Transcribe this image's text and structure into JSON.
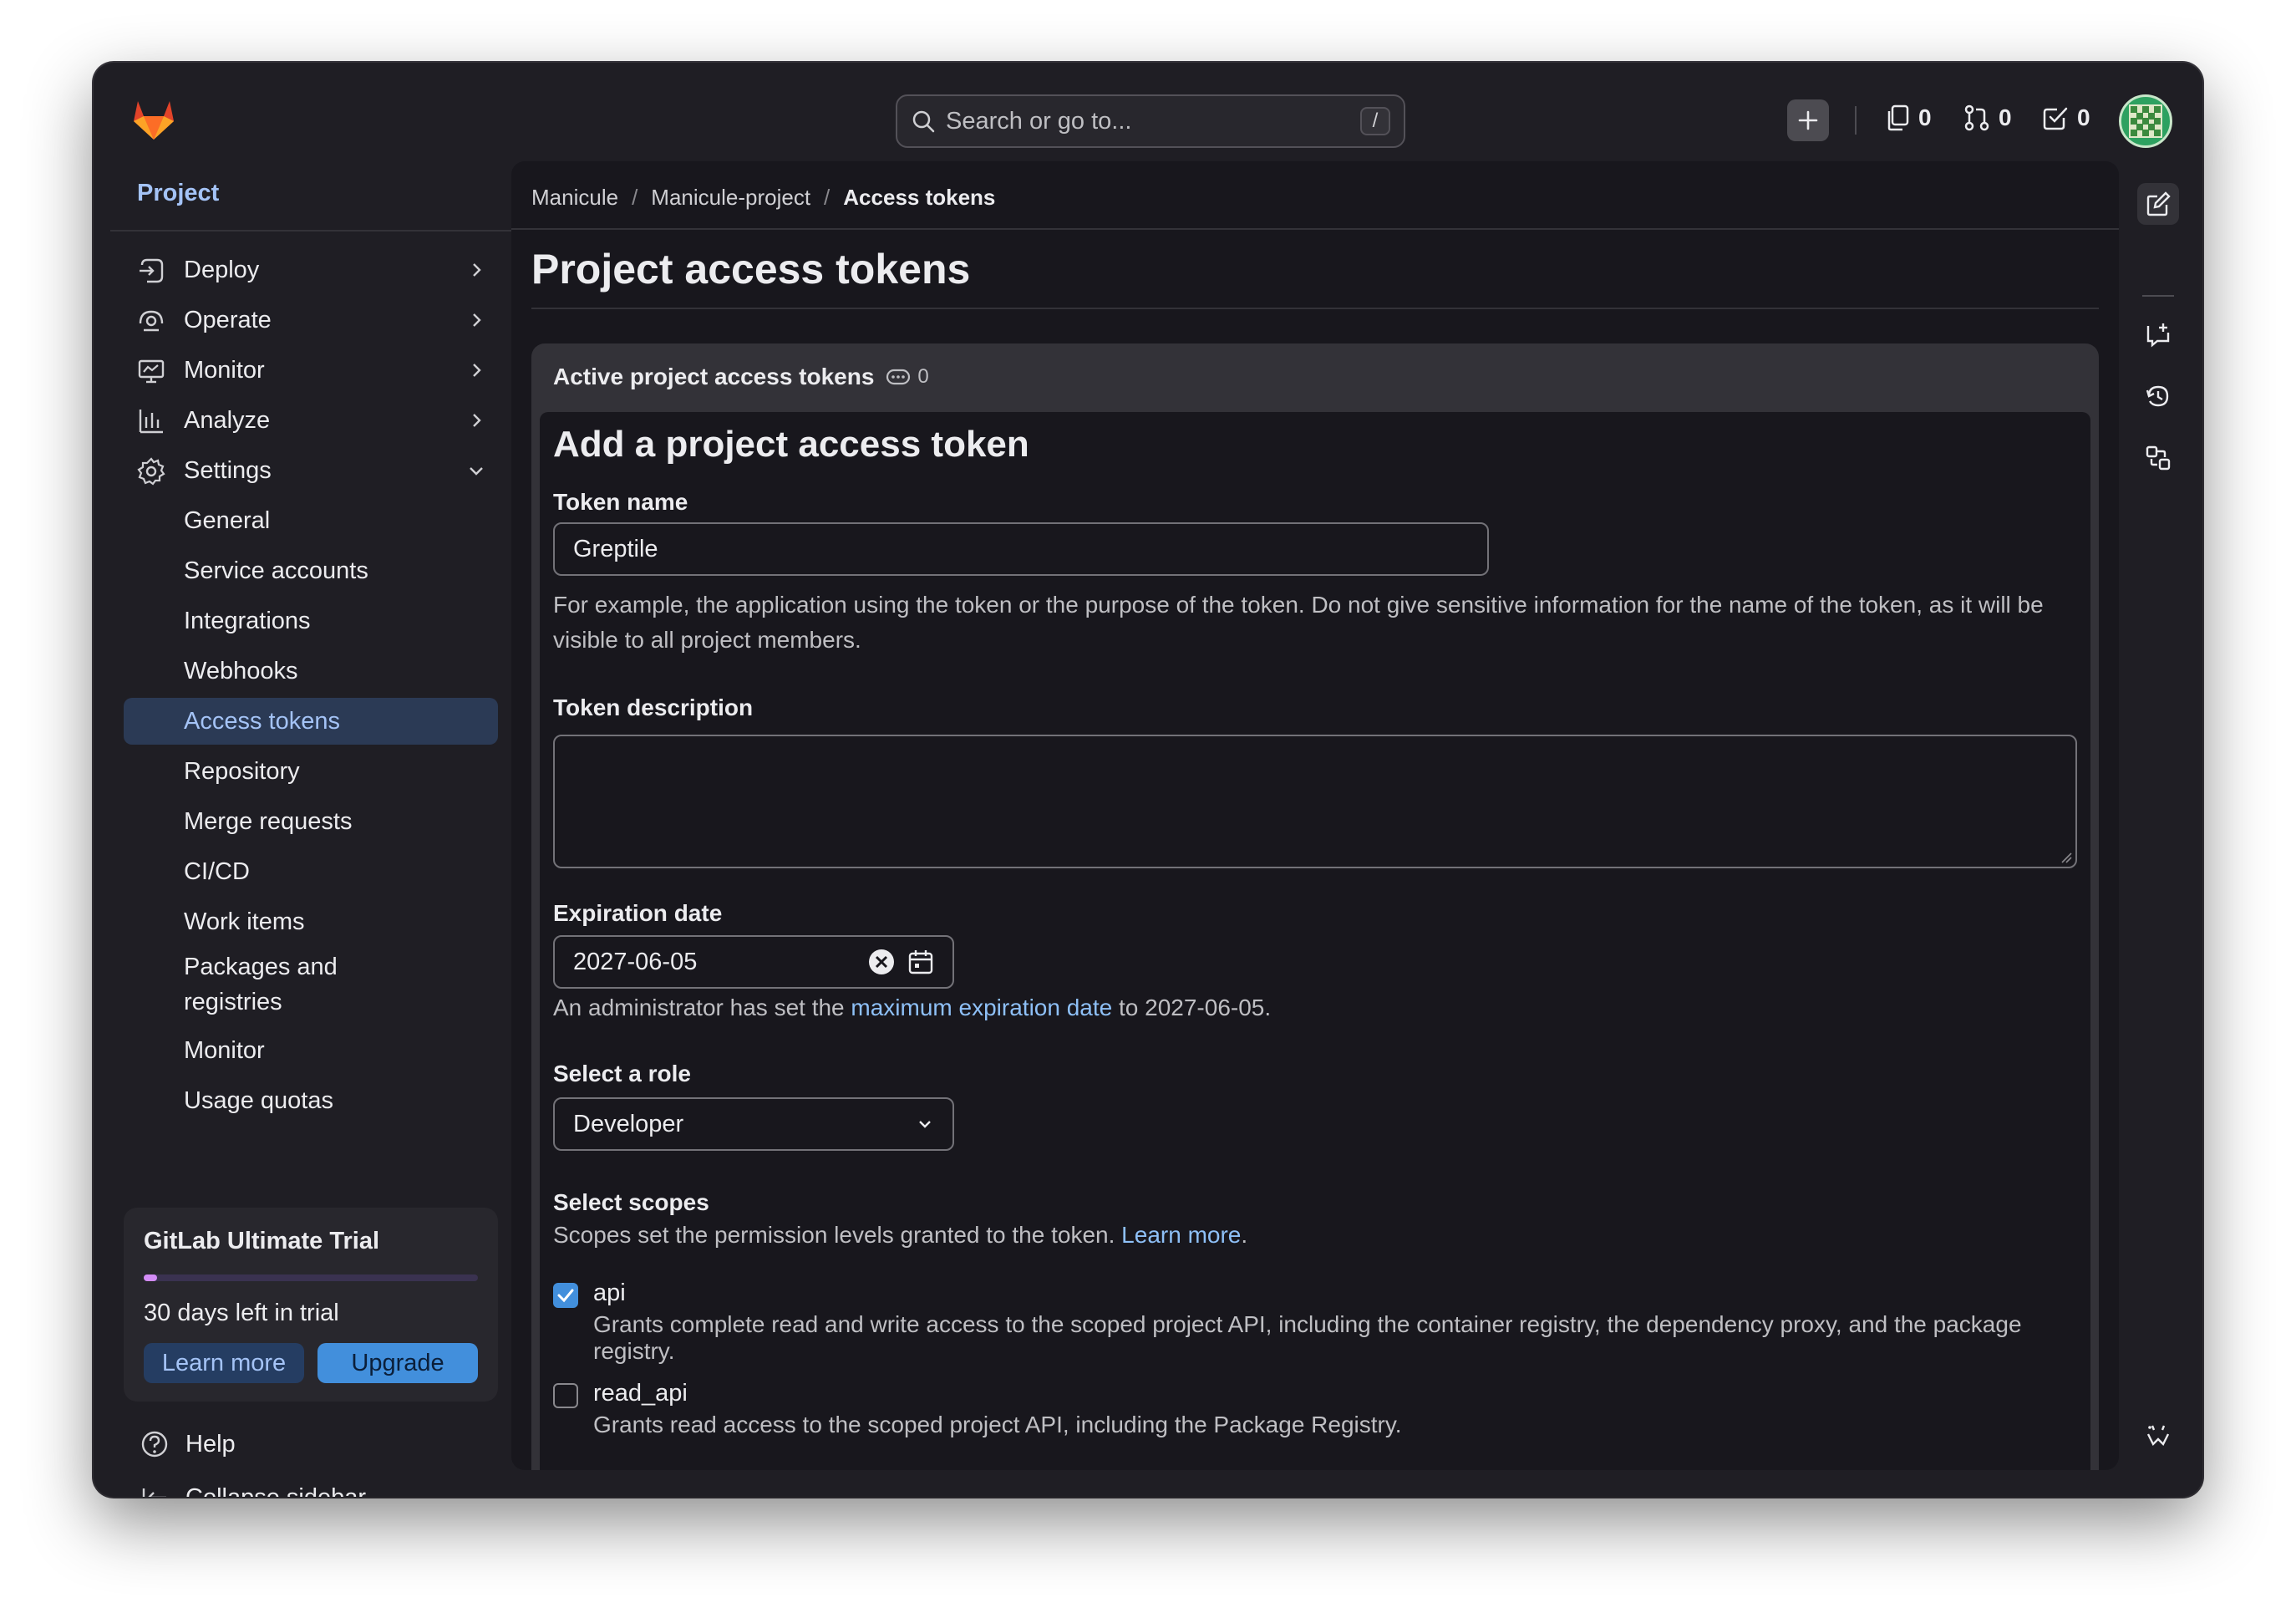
{
  "search": {
    "placeholder": "Search or go to...",
    "shortcut": "/"
  },
  "topbar": {
    "issues_count": "0",
    "merge_requests_count": "0",
    "todos_count": "0"
  },
  "sidebar": {
    "section": "Project",
    "items": [
      {
        "label": "Deploy",
        "icon": "deploy-icon"
      },
      {
        "label": "Operate",
        "icon": "operate-icon"
      },
      {
        "label": "Monitor",
        "icon": "monitor-icon"
      },
      {
        "label": "Analyze",
        "icon": "analyze-icon"
      },
      {
        "label": "Settings",
        "icon": "settings-icon"
      }
    ],
    "settings_sub": [
      "General",
      "Service accounts",
      "Integrations",
      "Webhooks",
      "Access tokens",
      "Repository",
      "Merge requests",
      "CI/CD",
      "Work items",
      "Packages and registries",
      "Monitor",
      "Usage quotas"
    ],
    "active": "Access tokens",
    "trial": {
      "title": "GitLab Ultimate Trial",
      "progress": 0.04,
      "days_left": "30 days left in trial",
      "learn_more": "Learn more",
      "upgrade": "Upgrade"
    },
    "help": "Help",
    "collapse": "Collapse sidebar"
  },
  "breadcrumb": [
    "Manicule",
    "Manicule-project",
    "Access tokens"
  ],
  "page_title": "Project access tokens",
  "card": {
    "header": "Active project access tokens",
    "token_count": "0",
    "form_title": "Add a project access token",
    "token_name_label": "Token name",
    "token_name_value": "Greptile",
    "token_name_help": "For example, the application using the token or the purpose of the token. Do not give sensitive information for the name of the token, as it will be visible to all project members.",
    "token_description_label": "Token description",
    "expiration_label": "Expiration date",
    "expiration_value": "2027-06-05",
    "expiration_help_prefix": "An administrator has set the ",
    "expiration_help_link": "maximum expiration date",
    "expiration_help_suffix": " to 2027-06-05.",
    "role_label": "Select a role",
    "role_value": "Developer",
    "scopes_label": "Select scopes",
    "scopes_help_prefix": "Scopes set the permission levels granted to the token. ",
    "scopes_help_link": "Learn more",
    "scopes_help_suffix": ".",
    "scopes": [
      {
        "name": "api",
        "checked": true,
        "desc": "Grants complete read and write access to the scoped project API, including the container registry, the dependency proxy, and the package registry."
      },
      {
        "name": "read_api",
        "checked": false,
        "desc": "Grants read access to the scoped project API, including the Package Registry."
      }
    ]
  },
  "colors": {
    "accent": "#428fdc",
    "link": "#8ec0f7",
    "background": "#1f1e24",
    "active_nav": "#2b3a55"
  }
}
